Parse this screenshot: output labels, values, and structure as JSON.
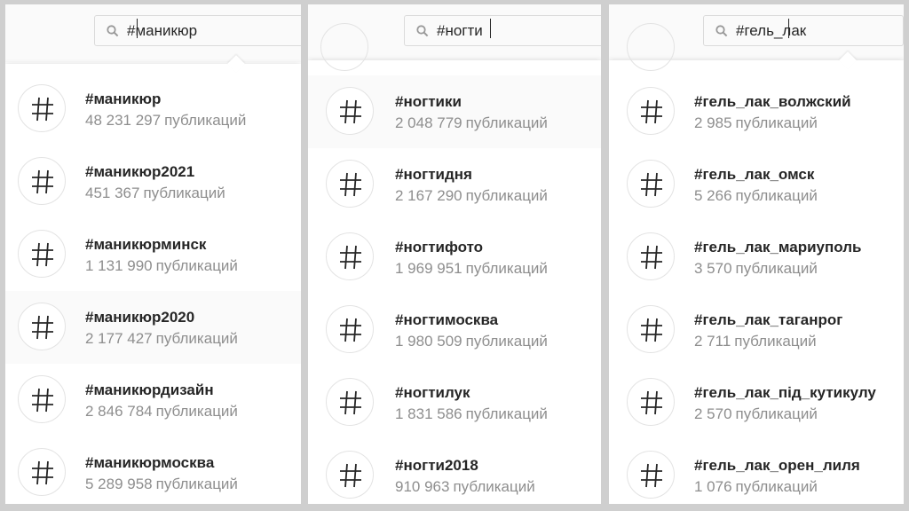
{
  "unit_label": "публикаций",
  "panels": [
    {
      "search": {
        "query": "#маникюр",
        "icon": "search-icon"
      },
      "results": [
        {
          "tag": "#маникюр",
          "count": "48 231 297"
        },
        {
          "tag": "#маникюр2021",
          "count": "451 367"
        },
        {
          "tag": "#маникюрминск",
          "count": "1 131 990"
        },
        {
          "tag": "#маникюр2020",
          "count": "2 177 427"
        },
        {
          "tag": "#маникюрдизайн",
          "count": "2 846 784"
        },
        {
          "tag": "#маникюрмосква",
          "count": "5 289 958"
        }
      ]
    },
    {
      "search": {
        "query": "#ногти",
        "icon": "search-icon"
      },
      "results": [
        {
          "tag": "#ногтики",
          "count": "2 048 779"
        },
        {
          "tag": "#ногтидня",
          "count": "2 167 290"
        },
        {
          "tag": "#ногтифото",
          "count": "1 969 951"
        },
        {
          "tag": "#ногтимосква",
          "count": "1 980 509"
        },
        {
          "tag": "#ногтилук",
          "count": "1 831 586"
        },
        {
          "tag": "#ногти2018",
          "count": "910 963"
        }
      ]
    },
    {
      "search": {
        "query": "#гель_лак",
        "icon": "search-icon"
      },
      "results": [
        {
          "tag": "#гель_лак_волжский",
          "count": "2 985"
        },
        {
          "tag": "#гель_лак_омск",
          "count": "5 266"
        },
        {
          "tag": "#гель_лак_мариуполь",
          "count": "3 570"
        },
        {
          "tag": "#гель_лак_таганрог",
          "count": "2 711"
        },
        {
          "tag": "#гель_лак_під_кутикулу",
          "count": "2 570"
        },
        {
          "tag": "#гель_лак_орен_лиля",
          "count": "1 076"
        }
      ]
    }
  ]
}
